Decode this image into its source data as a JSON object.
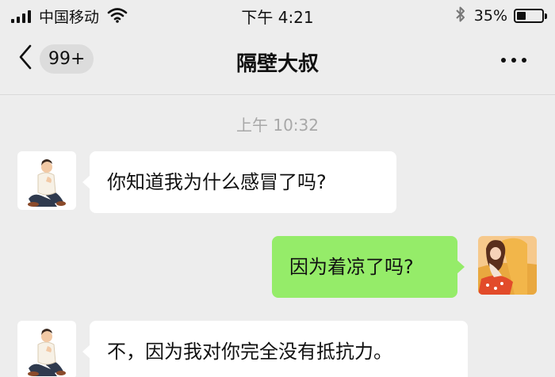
{
  "status_bar": {
    "carrier": "中国移动",
    "time": "下午 4:21",
    "battery_percent": "35%",
    "battery_level": 0.35,
    "icons": [
      "signal-icon",
      "wifi-icon",
      "bluetooth-icon",
      "battery-icon"
    ]
  },
  "nav": {
    "back_badge": "99+",
    "title": "隔壁大叔",
    "more_icon": "more-icon"
  },
  "chat": {
    "timestamp": "上午 10:32",
    "messages": [
      {
        "side": "left",
        "text": "你知道我为什么感冒了吗?"
      },
      {
        "side": "right",
        "text": "因为着凉了吗?"
      },
      {
        "side": "left",
        "text": "不，因为我对你完全没有抵抗力。"
      }
    ]
  },
  "colors": {
    "background": "#ededed",
    "incoming_bubble": "#ffffff",
    "outgoing_bubble": "#95ec69",
    "timestamp": "#a8a8a8"
  }
}
